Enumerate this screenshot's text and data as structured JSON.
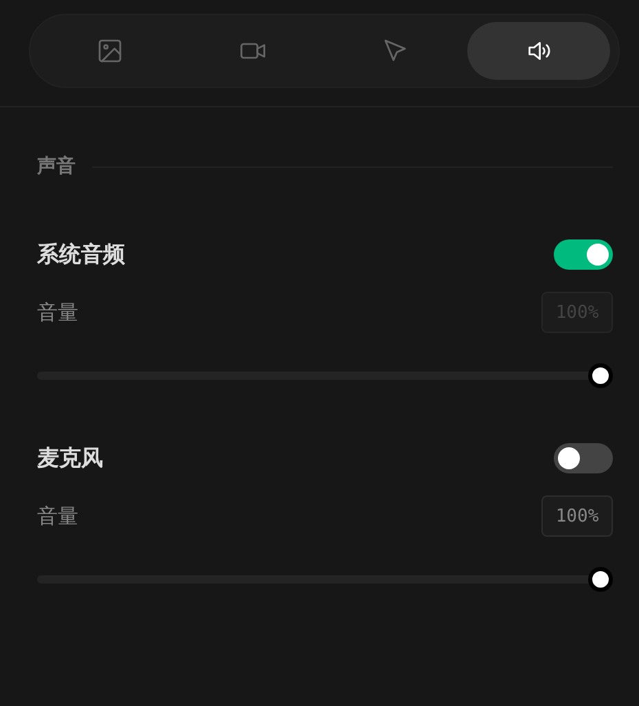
{
  "tabs": [
    {
      "kind": "image",
      "selected": false
    },
    {
      "kind": "video",
      "selected": false
    },
    {
      "kind": "cursor",
      "selected": false
    },
    {
      "kind": "sound",
      "selected": true
    }
  ],
  "section": {
    "title": "声音"
  },
  "sources": [
    {
      "name": "系统音频",
      "on": true,
      "volume_label": "音量",
      "volume_value": "100%",
      "disabled": true,
      "level": 1
    },
    {
      "name": "麦克风",
      "on": false,
      "volume_label": "音量",
      "volume_value": "100%",
      "disabled": false,
      "level": 1
    }
  ]
}
